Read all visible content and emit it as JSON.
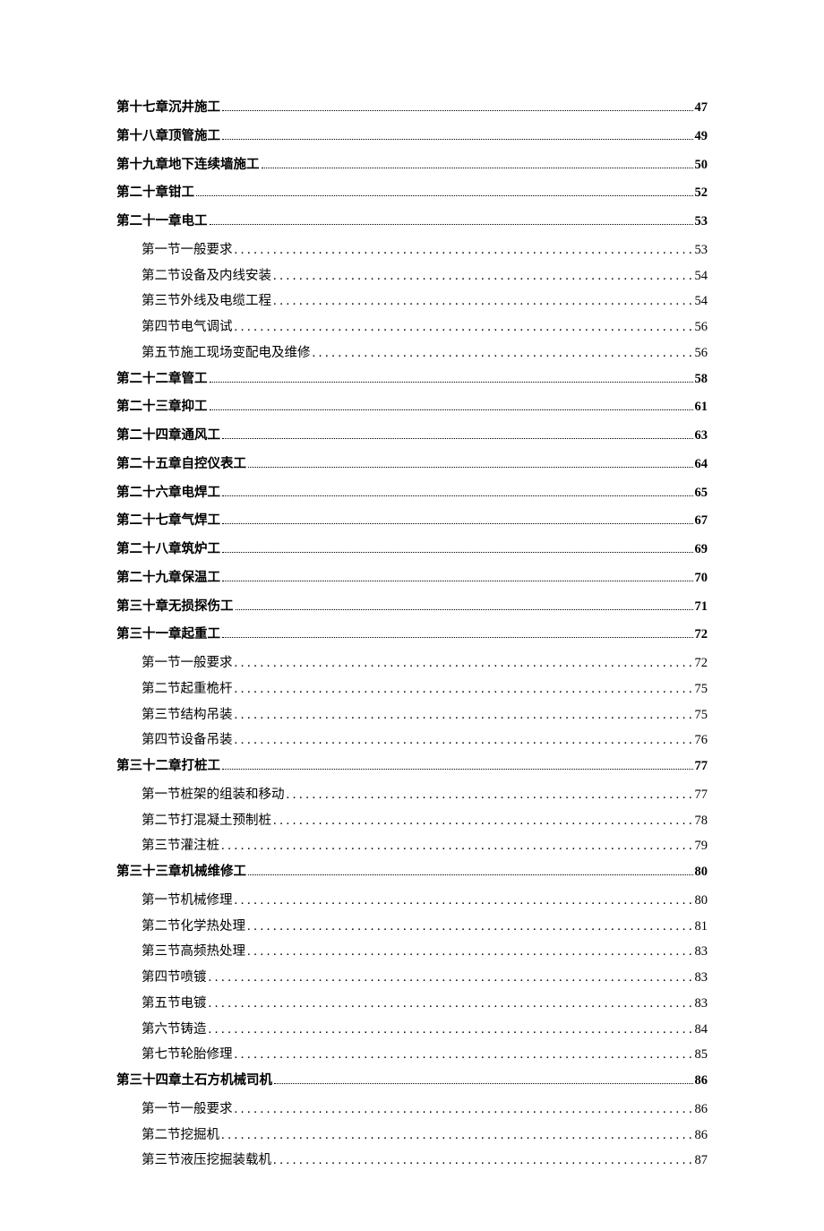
{
  "toc": [
    {
      "type": "chapter",
      "label": "第十七章沉井施工",
      "page": "47"
    },
    {
      "type": "chapter",
      "label": "第十八章顶管施工",
      "page": "49"
    },
    {
      "type": "chapter",
      "label": "第十九章地下连续墙施工",
      "page": "50"
    },
    {
      "type": "chapter",
      "label": "第二十章钳工",
      "page": "52"
    },
    {
      "type": "chapter",
      "label": "第二十一章电工",
      "page": "53"
    },
    {
      "type": "section",
      "label": "第一节一般要求",
      "page": "53"
    },
    {
      "type": "section",
      "label": "第二节设备及内线安装",
      "page": "54"
    },
    {
      "type": "section",
      "label": "第三节外线及电缆工程",
      "page": "54"
    },
    {
      "type": "section",
      "label": "第四节电气调试",
      "page": "56"
    },
    {
      "type": "section",
      "label": "第五节施工现场变配电及维修",
      "page": "56"
    },
    {
      "type": "chapter",
      "label": "第二十二章管工",
      "page": "58"
    },
    {
      "type": "chapter",
      "label": "第二十三章抑工",
      "page": "61"
    },
    {
      "type": "chapter",
      "label": "第二十四章通风工",
      "page": "63"
    },
    {
      "type": "chapter",
      "label": "第二十五章自控仪表工",
      "page": "64"
    },
    {
      "type": "chapter",
      "label": "第二十六章电焊工",
      "page": "65"
    },
    {
      "type": "chapter",
      "label": "第二十七章气焊工",
      "page": "67"
    },
    {
      "type": "chapter",
      "label": "第二十八章筑炉工",
      "page": "69"
    },
    {
      "type": "chapter",
      "label": "第二十九章保温工",
      "page": "70"
    },
    {
      "type": "chapter",
      "label": "第三十章无损探伤工",
      "page": "71"
    },
    {
      "type": "chapter",
      "label": "第三十一章起重工",
      "page": "72"
    },
    {
      "type": "section",
      "label": "第一节一般要求",
      "page": "72"
    },
    {
      "type": "section",
      "label": "第二节起重桅杆",
      "page": "75"
    },
    {
      "type": "section",
      "label": "第三节结构吊装",
      "page": "75"
    },
    {
      "type": "section",
      "label": "第四节设备吊装",
      "page": "76"
    },
    {
      "type": "chapter",
      "label": "第三十二章打桩工",
      "page": "77"
    },
    {
      "type": "section",
      "label": "第一节桩架的组装和移动",
      "page": "77"
    },
    {
      "type": "section",
      "label": "第二节打混凝土预制桩",
      "page": "78"
    },
    {
      "type": "section",
      "label": "第三节灌注桩",
      "page": "79"
    },
    {
      "type": "chapter",
      "label": "第三十三章机械维修工",
      "page": "80"
    },
    {
      "type": "section",
      "label": "第一节机械修理",
      "page": "80"
    },
    {
      "type": "section",
      "label": "第二节化学热处理",
      "page": "81"
    },
    {
      "type": "section",
      "label": "第三节高频热处理",
      "page": "83"
    },
    {
      "type": "section",
      "label": "第四节喷镀",
      "page": "83"
    },
    {
      "type": "section",
      "label": "第五节电镀",
      "page": "83"
    },
    {
      "type": "section",
      "label": "第六节铸造",
      "page": "84"
    },
    {
      "type": "section",
      "label": "第七节轮胎修理",
      "page": "85"
    },
    {
      "type": "chapter",
      "label": "第三十四章土石方机械司机",
      "page": "86"
    },
    {
      "type": "section",
      "label": "第一节一般要求",
      "page": "86"
    },
    {
      "type": "section",
      "label": "第二节挖掘机",
      "page": "86"
    },
    {
      "type": "section",
      "label": "第三节液压挖掘装载机",
      "page": "87"
    }
  ]
}
